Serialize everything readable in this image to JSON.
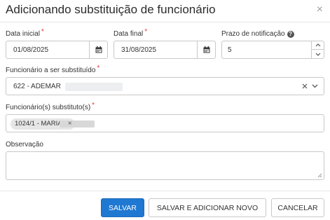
{
  "dialog": {
    "title": "Adicionando substituição de funcionário",
    "close_glyph": "×"
  },
  "fields": {
    "data_inicial": {
      "label": "Data inicial",
      "value": "01/08/2025",
      "icon": "calendar-icon"
    },
    "data_final": {
      "label": "Data final",
      "value": "31/08/2025",
      "icon": "calendar-icon"
    },
    "prazo": {
      "label": "Prazo de notificação",
      "value": "5",
      "help_glyph": "?"
    },
    "funcionario_substituido": {
      "label": "Funcionário a ser substituído",
      "value": "622 - ADEMAR"
    },
    "funcionarios_substitutos": {
      "label": "Funcionário(s) substituto(s)",
      "chips": [
        {
          "text": "1024/1 - MARIA"
        }
      ]
    },
    "observacao": {
      "label": "Observação",
      "value": ""
    }
  },
  "required_mark": "*",
  "buttons": {
    "salvar": "SALVAR",
    "salvar_adicionar": "SALVAR E ADICIONAR NOVO",
    "cancelar": "CANCELAR"
  },
  "colors": {
    "primary": "#1f78d1",
    "required": "#e53935"
  }
}
